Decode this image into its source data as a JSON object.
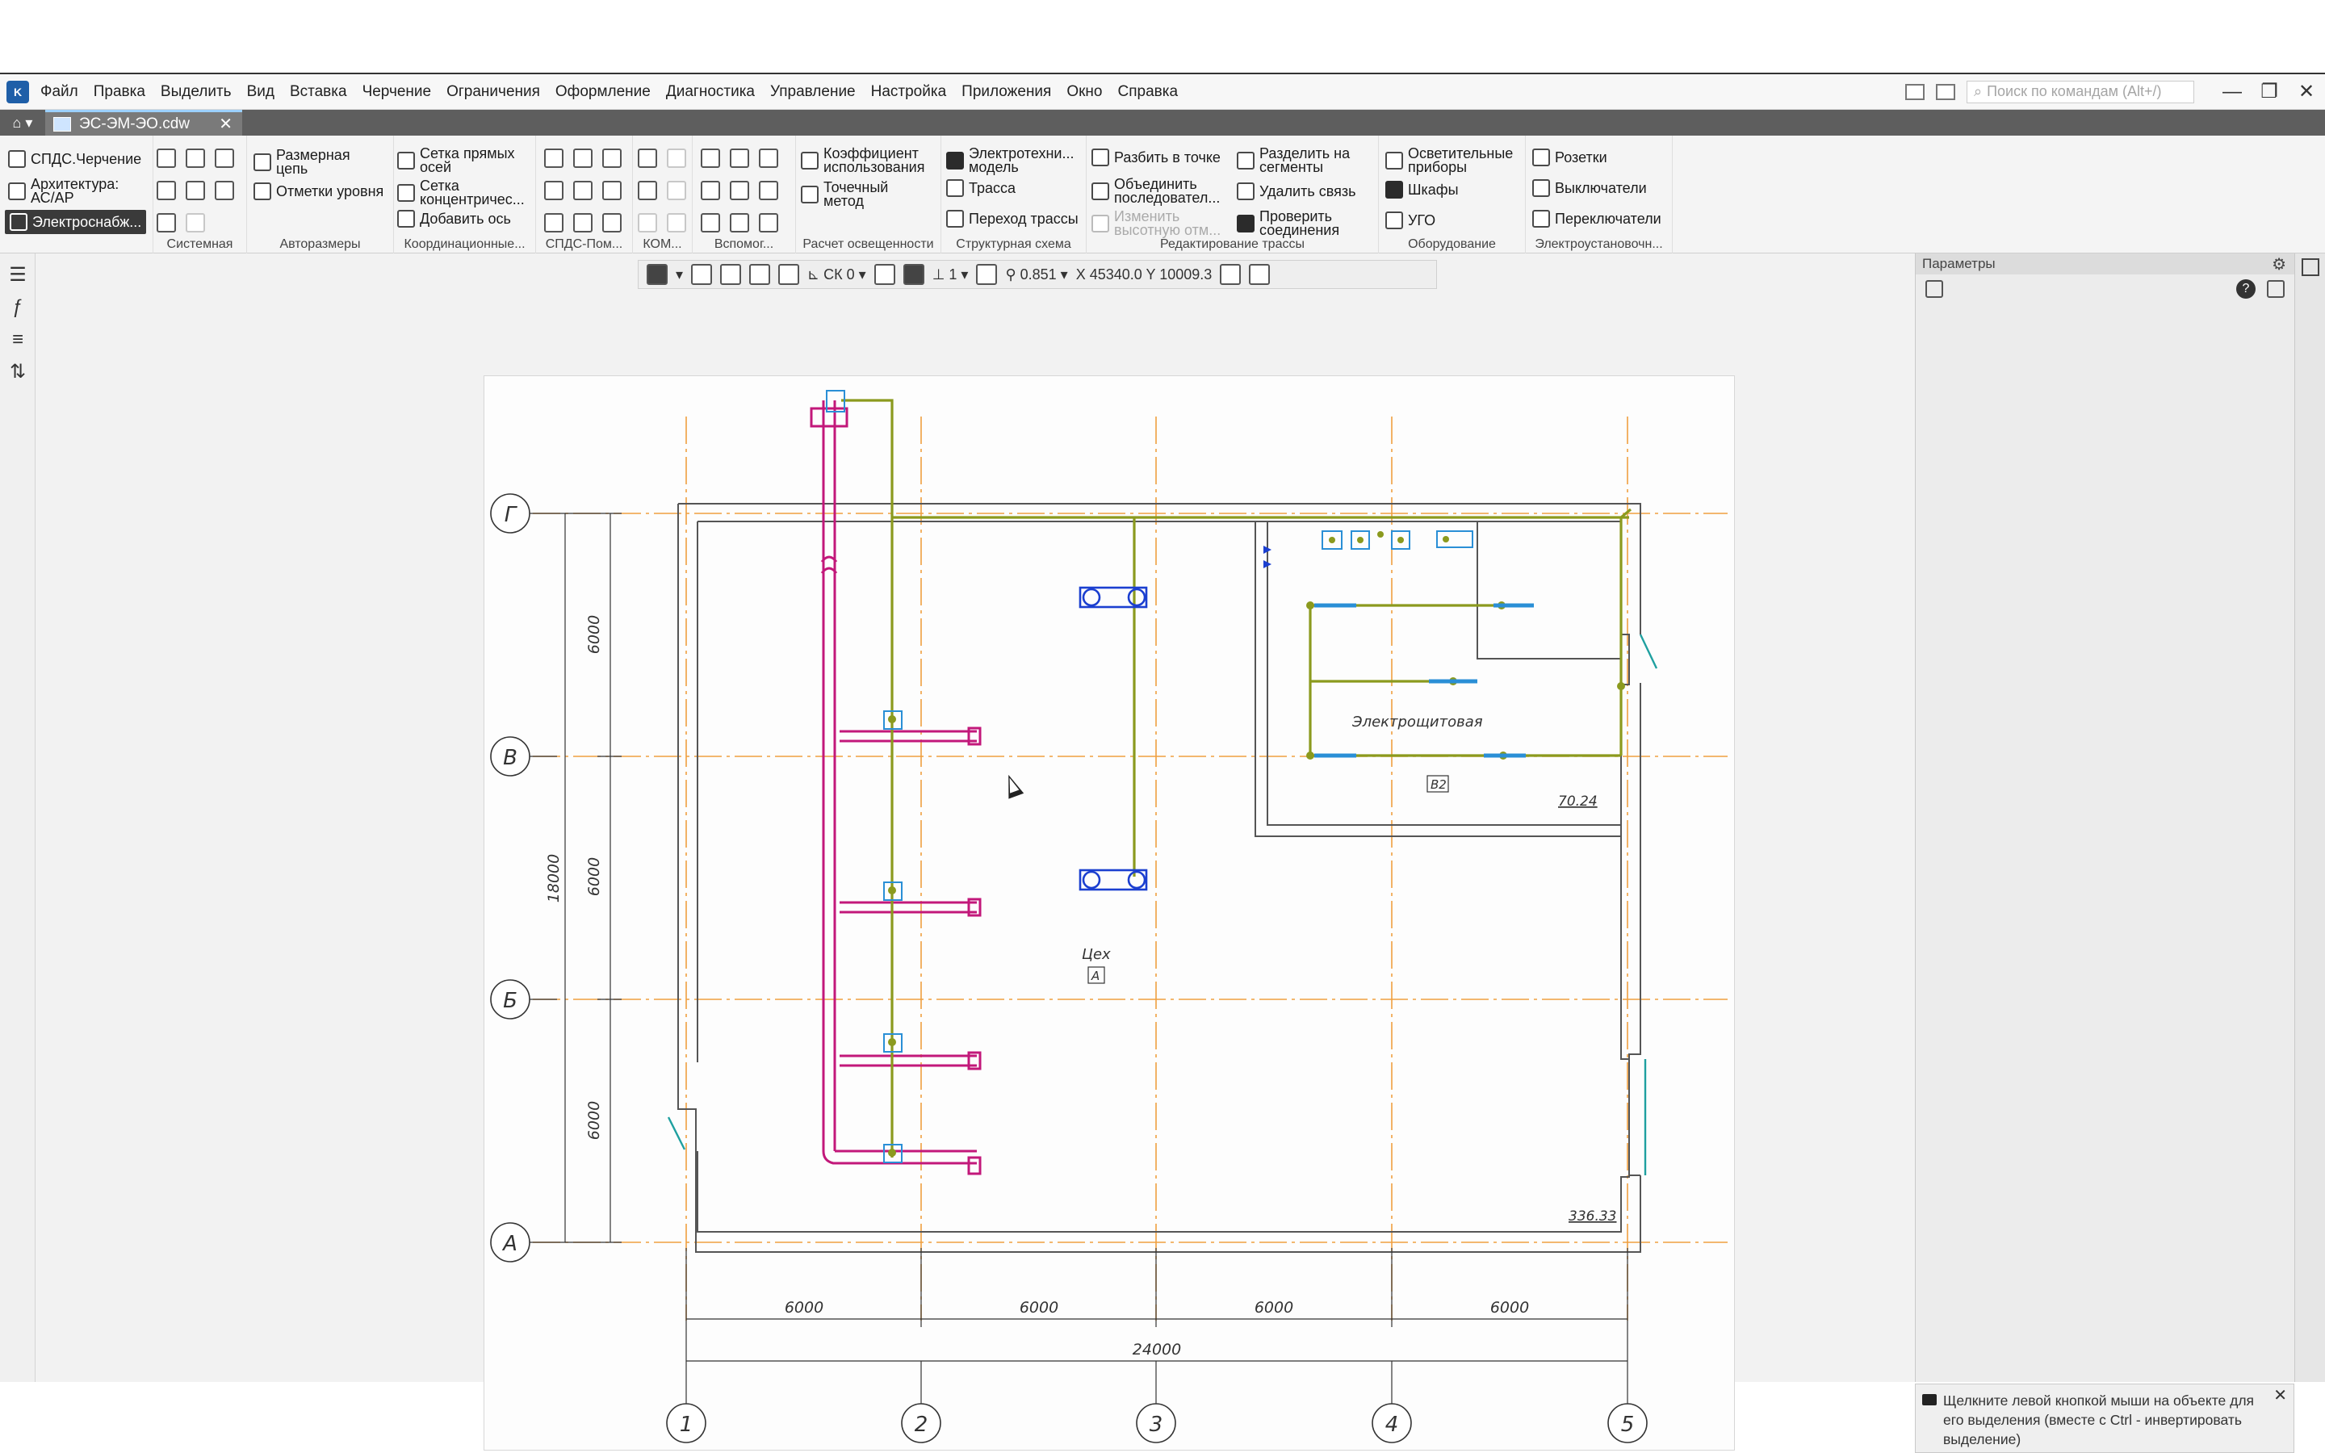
{
  "menu": {
    "items": [
      "Файл",
      "Правка",
      "Выделить",
      "Вид",
      "Вставка",
      "Черчение",
      "Ограничения",
      "Оформление",
      "Диагностика",
      "Управление",
      "Настройка",
      "Приложения",
      "Окно",
      "Справка"
    ],
    "search_placeholder": "Поиск по командам (Alt+/)"
  },
  "tabs": {
    "document": "ЭС-ЭМ-ЭО.cdw"
  },
  "ribbon": {
    "modes": [
      "СПДС.Черчение",
      "Архитектура: АС/АР",
      "Электроснабж..."
    ],
    "groups": {
      "system": "Системная",
      "autodim": "Авторазмеры",
      "coord": "Координационные...",
      "spds": "СПДС-Пом...",
      "kom": "КОМ...",
      "aux": "Вспомог...",
      "light_calc": "Расчет освещенности",
      "struct": "Структурная схема",
      "route_edit": "Редактирование трассы",
      "equipment": "Оборудование",
      "install": "Электроустановочн..."
    },
    "autodim": {
      "chain": "Размерная цепь",
      "levels": "Отметки уровня"
    },
    "coord": {
      "straight": "Сетка прямых осей",
      "concentric": "Сетка концентричес...",
      "add_axis": "Добавить ось"
    },
    "light": {
      "coef": "Коэффициент использования",
      "point": "Точечный метод"
    },
    "struct": {
      "model": "Электротехни... модель",
      "route": "Трасса",
      "transition": "Переход трассы"
    },
    "route_edit": {
      "split_point": "Разбить в точке",
      "merge": "Объединить последовател...",
      "change_height": "Изменить высотную отм...",
      "split_segments": "Разделить на сегменты",
      "delete_link": "Удалить связь",
      "check_conn": "Проверить соединения"
    },
    "equipment": {
      "lights": "Осветительные приборы",
      "cabinets": "Шкафы",
      "ugo": "УГО"
    },
    "install": {
      "sockets": "Розетки",
      "switches": "Выключатели",
      "toggles": "Переключатели"
    }
  },
  "drawbar": {
    "cs": "СК 0",
    "layer": "1",
    "zoom": "0.851",
    "x_label": "X",
    "x_value": "45340.0",
    "y_label": "Y",
    "y_value": "10009.3"
  },
  "panel": {
    "title": "Параметры",
    "hint": "Щелкните левой кнопкой мыши на объекте для его выделения (вместе с Ctrl - инвертировать выделение)"
  },
  "plan": {
    "axes_rows": [
      "Г",
      "В",
      "Б",
      "А"
    ],
    "axes_cols": [
      "1",
      "2",
      "3",
      "4",
      "5"
    ],
    "dim_vertical": [
      "6000",
      "6000",
      "6000",
      "18000"
    ],
    "dim_horizontal": [
      "6000",
      "6000",
      "6000",
      "6000",
      "24000"
    ],
    "rooms": {
      "panel_room": "Электрощитовая",
      "panel_room_tag": "В2",
      "panel_room_area": "70.24",
      "shop": "Цех",
      "shop_tag": "А",
      "shop_area": "336.33"
    },
    "colors": {
      "axis": "#f0a040",
      "walls": "#555555",
      "route": "#8b9a1e",
      "busbar": "#c2187a",
      "equipment": "#1b3fd0",
      "accent": "#2a8fd6"
    }
  }
}
